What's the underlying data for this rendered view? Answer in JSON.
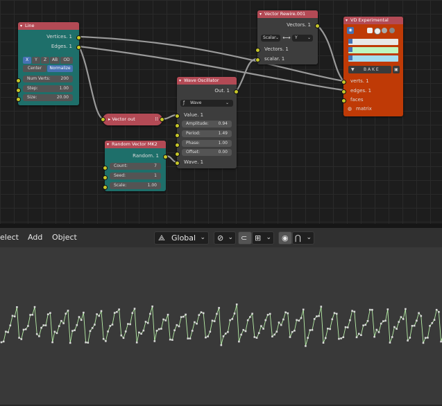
{
  "nodes": {
    "line": {
      "title": "Line",
      "outputs": [
        "Vertices. 1",
        "Edges. 1"
      ],
      "dims": [
        "X",
        "Y",
        "Z",
        "AB",
        "OD"
      ],
      "center_label": "Center",
      "normalize_label": "Normalize",
      "fields": [
        {
          "label": "Num Verts:",
          "value": "200"
        },
        {
          "label": "Step:",
          "value": "1.00"
        },
        {
          "label": "Size:",
          "value": "20.00"
        }
      ]
    },
    "vector_out": {
      "title": "Vector out"
    },
    "random_vector": {
      "title": "Random Vector MK2",
      "output": "Random. 1",
      "fields": [
        {
          "label": "Count:",
          "value": "7"
        },
        {
          "label": "Seed:",
          "value": "1"
        },
        {
          "label": "Scale:",
          "value": "1.00"
        }
      ]
    },
    "wave": {
      "title": "Wave Oscillator",
      "output": "Out. 1",
      "mode": "Wave",
      "value_in": "Value. 1",
      "fields": [
        {
          "label": "Amplitude:",
          "value": "0.94"
        },
        {
          "label": "Period:",
          "value": "1.49"
        },
        {
          "label": "Phase:",
          "value": "1.00"
        },
        {
          "label": "Offset:",
          "value": "0.00"
        }
      ],
      "wave_in": "Wave. 1"
    },
    "rewire": {
      "title": "Vector Rewire.001",
      "output": "Vectors. 1",
      "from": "Scalar",
      "to": "Y",
      "inputs": [
        "Vectors. 1",
        "scalar. 1"
      ]
    },
    "vd": {
      "title": "VD Experimental",
      "bake_label": "B A K E",
      "inputs": [
        "verts. 1",
        "edges. 1",
        "faces",
        "matrix"
      ],
      "swatch_colors": [
        "#e8e8e8",
        "#bff5c0",
        "#a4dcf0"
      ]
    }
  },
  "toolbar": {
    "menus": [
      "elect",
      "Add",
      "Object"
    ],
    "orientation": "Global"
  },
  "viewport": {
    "line_color": "#b8f0a8",
    "vertex_color": "#d8d8d8"
  },
  "icons": [
    "transform-orientation-icon",
    "pivot-icon",
    "snap-icon",
    "snap-target-icon",
    "proportional-edit-icon",
    "falloff-icon",
    "wave-icon",
    "bake-icon",
    "view-icon"
  ]
}
